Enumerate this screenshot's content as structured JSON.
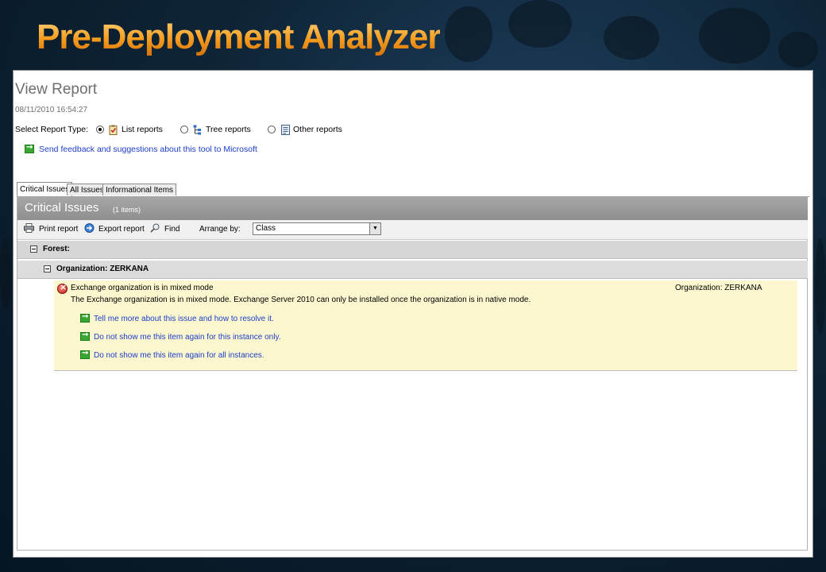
{
  "slide": {
    "title": "Pre-Deployment Analyzer"
  },
  "report": {
    "title": "View Report",
    "date": "08/11/2010 16:54:27",
    "type_label": "Select Report Type:",
    "types": [
      {
        "label": "List reports",
        "selected": true
      },
      {
        "label": "Tree reports",
        "selected": false
      },
      {
        "label": "Other reports",
        "selected": false
      }
    ],
    "feedback_link": "Send feedback and suggestions about this tool to Microsoft"
  },
  "tabs": [
    {
      "label": "Critical Issues",
      "active": true
    },
    {
      "label": "All Issues",
      "active": false
    },
    {
      "label": "Informational Items",
      "active": false
    }
  ],
  "panel": {
    "title": "Critical Issues",
    "count": "(1 items)",
    "toolbar": {
      "print": "Print report",
      "export": "Export report",
      "find": "Find",
      "arrange_label": "Arrange by:",
      "arrange_value": "Class"
    },
    "groups": {
      "forest": "Forest:",
      "organization": "Organization: ZERKANA"
    },
    "issue": {
      "title": "Exchange organization is in mixed mode",
      "description": "The Exchange organization is in mixed mode. Exchange Server 2010 can only be installed once the organization is in native mode.",
      "scope": "Organization: ZERKANA",
      "links": [
        "Tell me more about this issue and how to resolve it.",
        "Do not show me this item again for this instance only.",
        "Do not show me this item again for all instances."
      ]
    }
  },
  "colors": {
    "title_orange": "#f39a2b",
    "link_blue": "#1a3ec9",
    "issue_background": "#fcf7cf",
    "header_gray": "#999999"
  }
}
